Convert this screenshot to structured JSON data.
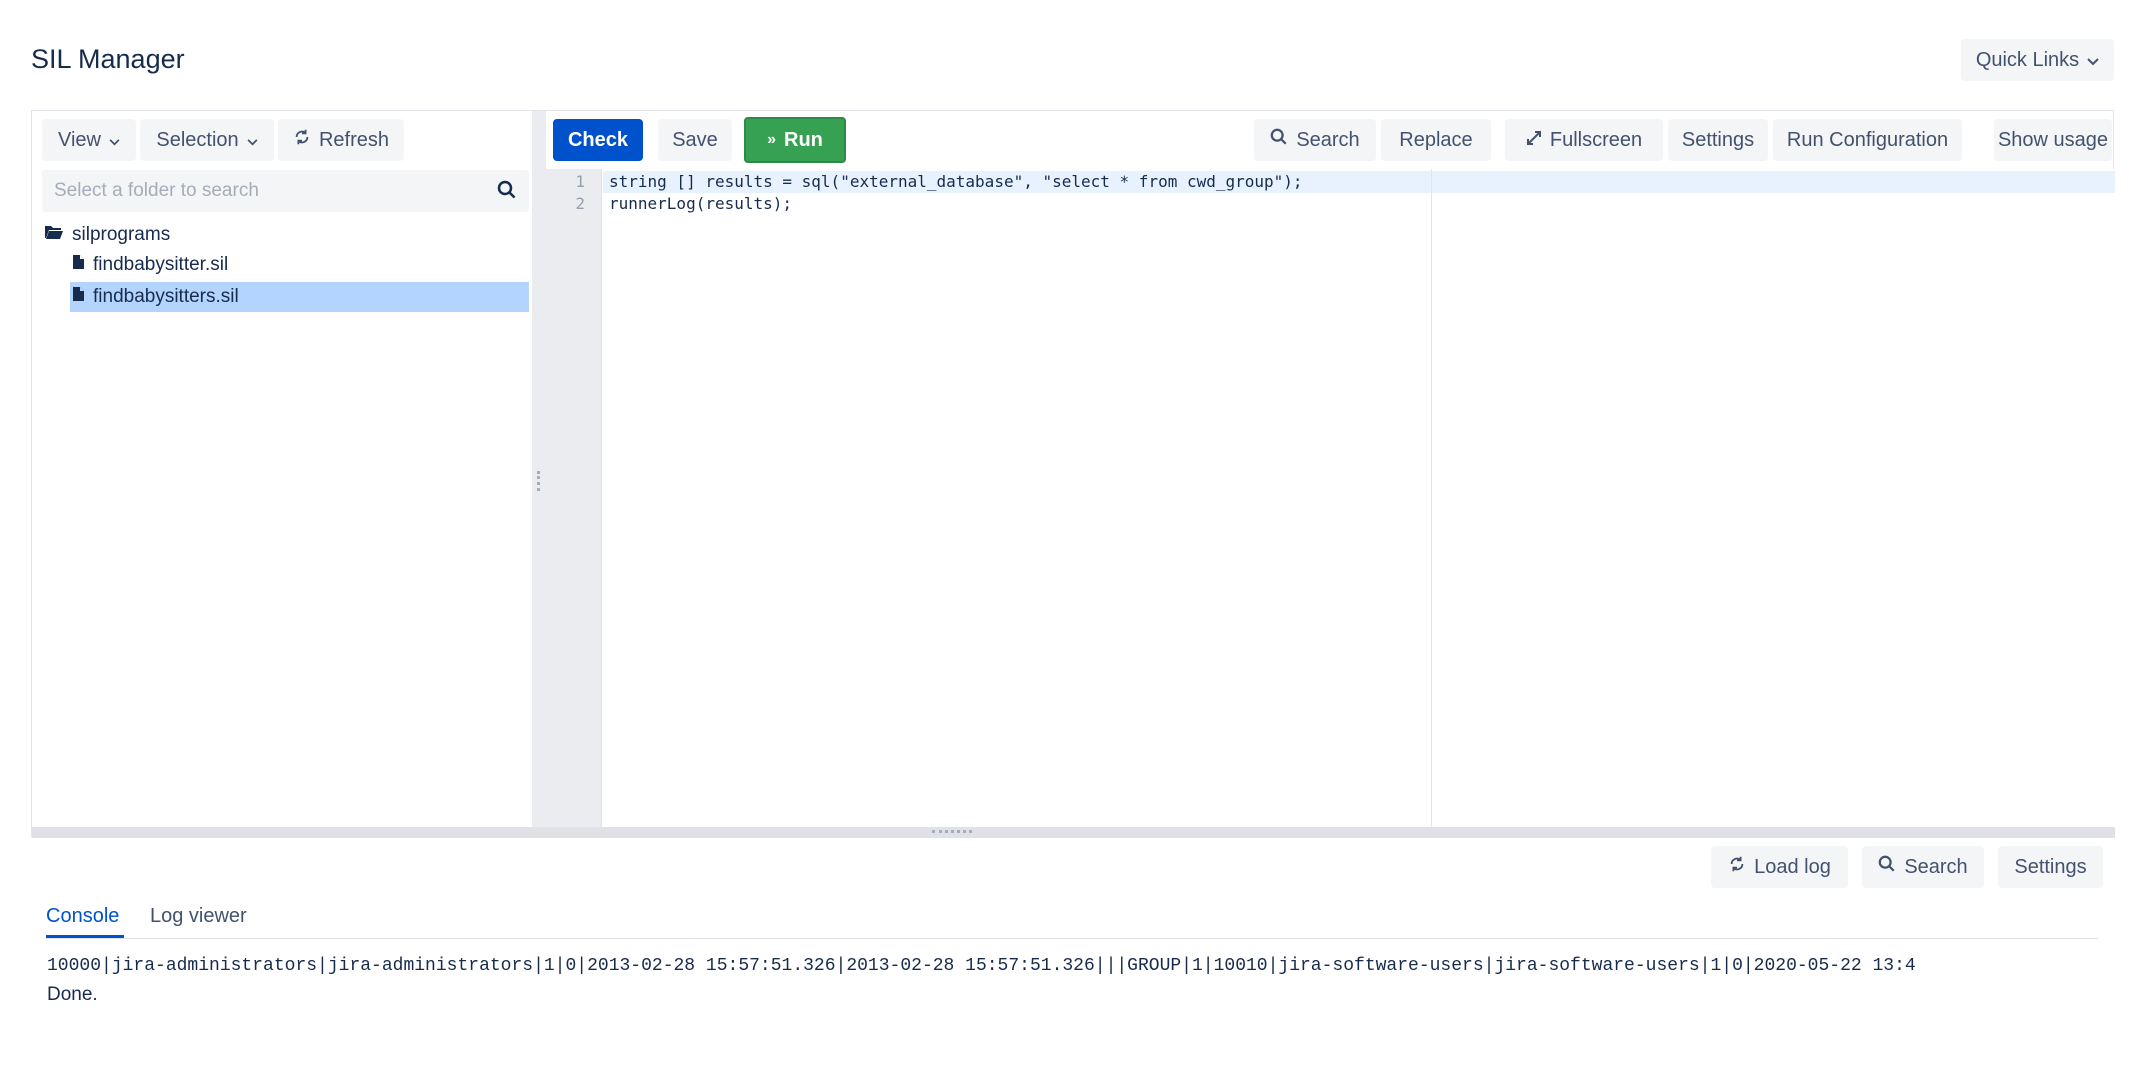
{
  "page": {
    "title": "SIL Manager",
    "quick_links": "Quick Links"
  },
  "left_panel": {
    "view_label": "View",
    "selection_label": "Selection",
    "refresh_label": "Refresh",
    "search_placeholder": "Select a folder to search",
    "tree": {
      "folder": "silprograms",
      "files": [
        "findbabysitter.sil",
        "findbabysitters.sil"
      ],
      "selected_index": 1
    }
  },
  "editor_toolbar": {
    "check": "Check",
    "save": "Save",
    "run": "Run",
    "search": "Search",
    "replace": "Replace",
    "fullscreen": "Fullscreen",
    "settings": "Settings",
    "run_configuration": "Run Configuration",
    "show_usage": "Show usage"
  },
  "editor": {
    "line_numbers": [
      "1",
      "2"
    ],
    "lines": [
      "string [] results = sql(\"external_database\", \"select * from cwd_group\");",
      "runnerLog(results);"
    ]
  },
  "console": {
    "load_log": "Load log",
    "search": "Search",
    "settings": "Settings",
    "tabs": [
      "Console",
      "Log viewer"
    ],
    "active_tab": "Console",
    "output_line": "10000|jira-administrators|jira-administrators|1|0|2013-02-28 15:57:51.326|2013-02-28 15:57:51.326|||GROUP|1|10010|jira-software-users|jira-software-users|1|0|2020-05-22 13:4",
    "status": "Done."
  },
  "colors": {
    "primary": "#0052cc",
    "run": "#36a152",
    "selected": "#b3d4ff"
  },
  "icons": [
    "chevron-down-icon",
    "refresh-icon",
    "search-icon",
    "folder-open-icon",
    "file-icon",
    "run-icon",
    "expand-icon"
  ]
}
